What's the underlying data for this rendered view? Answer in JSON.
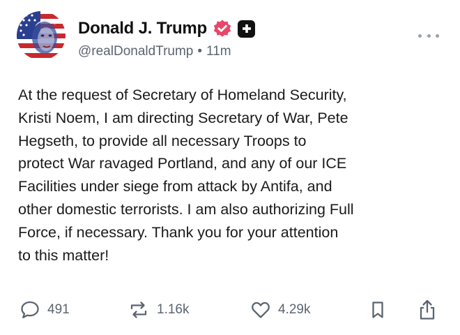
{
  "post": {
    "author": {
      "display_name": "Donald J. Trump",
      "handle": "@realDonaldTrump",
      "separator": "•",
      "timestamp": "11m",
      "verified_color": "#e8476a",
      "avatar_icon": "american-flag-portrait"
    },
    "text": "At the request of Secretary of Homeland Security,\nKristi Noem, I am directing Secretary of War, Pete\nHegseth, to provide all necessary Troops to\nprotect War ravaged Portland, and any of our ICE\nFacilities under siege from attack by Antifa, and\nother domestic terrorists. I am also authorizing Full\nForce, if necessary. Thank you for your attention\nto this matter!",
    "actions": {
      "replies": "491",
      "reposts": "1.16k",
      "likes": "4.29k"
    },
    "icons": {
      "reply": "speech-bubble-icon",
      "repost": "repost-arrows-icon",
      "like": "heart-icon",
      "bookmark": "bookmark-icon",
      "share": "share-icon",
      "more": "more-dots-icon"
    }
  }
}
